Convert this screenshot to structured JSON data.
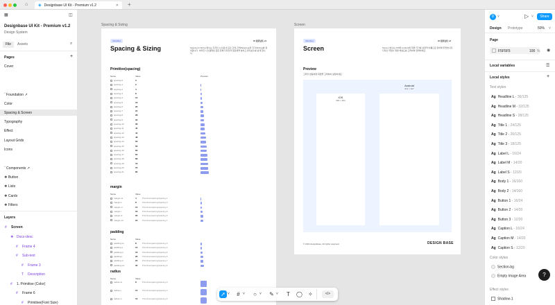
{
  "window": {
    "tab_title": "Designbase UI Kit - Premium v1.2",
    "new_tab": "+"
  },
  "left_panel": {
    "file_title": "Designbase UI Kit - Premium v1.2",
    "file_subtitle": "Design System",
    "tabs": [
      "File",
      "Assets"
    ],
    "pages_header": "Pages",
    "pages": [
      {
        "label": "Cover"
      },
      {
        "label": "ˇ Foundation ↗"
      },
      {
        "label": "Color"
      },
      {
        "label": "Spacing & Screen",
        "selected": true
      },
      {
        "label": "Typography"
      },
      {
        "label": "Effect"
      },
      {
        "label": "Layout Grids"
      },
      {
        "label": "Icons"
      },
      {
        "label": "ˇ Components ↗"
      },
      {
        "label": "❖ Button"
      },
      {
        "label": "❖ Lists"
      },
      {
        "label": "❖ Cards"
      },
      {
        "label": "❖ Filters"
      }
    ],
    "layers_header": "Layers",
    "layers": [
      {
        "label": "Screen",
        "icon": "frame"
      },
      {
        "label": "Docs-desc",
        "icon": "component"
      },
      {
        "label": "Frame 4",
        "icon": "frame"
      },
      {
        "label": "Sub-text",
        "icon": "frame"
      },
      {
        "label": "Frame 3",
        "icon": "frame"
      },
      {
        "label": "Description",
        "icon": "text"
      },
      {
        "label": "1. Primitive (Color)",
        "icon": "frame"
      },
      {
        "label": "Frame 6",
        "icon": "frame"
      },
      {
        "label": "Primitive(Font Size)",
        "icon": "frame"
      },
      {
        "label": "Preview",
        "icon": "text"
      }
    ]
  },
  "canvas": {
    "frame1": {
      "label": "Spacing & Sizing",
      "badge": "Variables",
      "title": "Spacing & Sizing",
      "version": "UI 컴포넌트 v1",
      "desc": "Spacing & Sizing 변수는 디자인 시스템 내 요소 간의 간격(Spacing)과 크기(Sizing)를 정의합니다. 이러한 시스템화된 값은 전체 디자인의 일관성을 높이고 유지보수를 쉽게 합니다.",
      "section1": "Primitive(spacing)",
      "col_name": "Name",
      "col_value": "Value",
      "col_preview": "Preview",
      "spacing": [
        {
          "name": "spacing-0",
          "value": "0"
        },
        {
          "name": "spacing-1",
          "value": "2"
        },
        {
          "name": "spacing-2",
          "value": "4"
        },
        {
          "name": "spacing-3",
          "value": "8"
        },
        {
          "name": "spacing-4",
          "value": "12"
        },
        {
          "name": "spacing-5",
          "value": "16"
        },
        {
          "name": "spacing-6",
          "value": "20"
        },
        {
          "name": "spacing-7",
          "value": "24"
        },
        {
          "name": "spacing-8",
          "value": "28"
        },
        {
          "name": "spacing-9",
          "value": "32"
        },
        {
          "name": "spacing-10",
          "value": "36"
        },
        {
          "name": "spacing-11",
          "value": "40"
        },
        {
          "name": "spacing-12",
          "value": "44"
        },
        {
          "name": "spacing-13",
          "value": "48"
        },
        {
          "name": "spacing-14",
          "value": "52"
        },
        {
          "name": "spacing-15",
          "value": "56"
        },
        {
          "name": "spacing-16",
          "value": "60"
        },
        {
          "name": "spacing-17",
          "value": "64"
        },
        {
          "name": "spacing-18",
          "value": "68"
        },
        {
          "name": "spacing-19",
          "value": "72"
        },
        {
          "name": "spacing-20",
          "value": "76"
        },
        {
          "name": "spacing-21",
          "value": "80"
        }
      ],
      "section2": "margin",
      "margin": [
        {
          "name": "margin-xs",
          "value": "4",
          "ref": "Primitive/spacing/spacing-1"
        },
        {
          "name": "margin-s",
          "value": "8",
          "ref": "Primitive/spacing/spacing-3"
        },
        {
          "name": "margin-m",
          "value": "12",
          "ref": "Primitive/spacing/spacing-4"
        },
        {
          "name": "margin-l",
          "value": "16",
          "ref": "Primitive/spacing/spacing-5"
        },
        {
          "name": "margin-xl",
          "value": "20",
          "ref": "Primitive/spacing/spacing-6"
        },
        {
          "name": "margin-xxl",
          "value": "24",
          "ref": "Primitive/spacing/spacing-7"
        }
      ],
      "section3": "padding",
      "padding": [
        {
          "name": "padding-xs",
          "value": "8",
          "ref": "Primitive/spacing/spacing-3"
        },
        {
          "name": "padding-s",
          "value": "12",
          "ref": "Primitive/spacing/spacing-4"
        },
        {
          "name": "padding-m",
          "value": "16",
          "ref": "Primitive/spacing/spacing-5"
        },
        {
          "name": "padding-l",
          "value": "20",
          "ref": "Primitive/spacing/spacing-6"
        },
        {
          "name": "padding-xl",
          "value": "24",
          "ref": "Primitive/spacing/spacing-7"
        },
        {
          "name": "padding-xxl",
          "value": "32",
          "ref": "Primitive/spacing/spacing-9"
        }
      ],
      "section4": "radius",
      "radius": [
        {
          "name": "radius-xs",
          "value": "8",
          "ref": "Primitive/spacing/spacing-3"
        },
        {
          "name": "radius-s",
          "value": "12",
          "ref": "Primitive/spacing/spacing-4"
        },
        {
          "name": "radius-m",
          "value": "16",
          "ref": "Primitive/spacing/spacing-5"
        },
        {
          "name": "radius-l",
          "value": "20",
          "ref": "Primitive/spacing/spacing-6"
        }
      ]
    },
    "frame2": {
      "label": "Screen",
      "badge": "Variables",
      "title": "Screen",
      "version": "UI 컴포넌트 v1",
      "desc": "Screen 변수는 iOS와 Android의 화면 크기를 상징적 이름으로 정의해 두었습니다. 디자인 작업시 화면 해상도를 고려하여 선택하세요.",
      "section1": "Preview",
      "preview_desc": "고려할 변동하면 화면을 고려하여 설정하세요.",
      "ios_label": "iOS",
      "ios_size": "390 × 844",
      "android_label": "Android",
      "android_size": "412 × 917",
      "footer_left": "© 2024 designbase. All rights reserved.",
      "footer_right": "DESIGN BASE"
    }
  },
  "toolbar": {
    "tools": [
      "move-tool",
      "frame-tool",
      "shape-tool",
      "pen-tool",
      "text-tool",
      "comment-tool",
      "actions-tool",
      "dev-mode-toggle"
    ]
  },
  "right_panel": {
    "avatar_letter": "D",
    "share_label": "Share",
    "tabs": [
      "Design",
      "Prototype"
    ],
    "zoom": "50%",
    "page_header": "Page",
    "page_color": "F5F5F5",
    "page_opacity": "100",
    "page_opacity_unit": "%",
    "local_variables": "Local variables",
    "local_styles": "Local styles",
    "text_styles_header": "Text styles",
    "text_styles": [
      {
        "name": "Headline L",
        "size": "36/125"
      },
      {
        "name": "Headline M",
        "size": "32/125"
      },
      {
        "name": "Headline S",
        "size": "28/125"
      },
      {
        "name": "Title 1",
        "size": "24/125"
      },
      {
        "name": "Title 2",
        "size": "20/125"
      },
      {
        "name": "Title 3",
        "size": "18/125"
      },
      {
        "name": "Label L",
        "size": "16/24"
      },
      {
        "name": "Label M",
        "size": "14/20"
      },
      {
        "name": "Label S",
        "size": "12/20"
      },
      {
        "name": "Body 1",
        "size": "16/160"
      },
      {
        "name": "Body 2",
        "size": "14/160"
      },
      {
        "name": "Button 1",
        "size": "16/24"
      },
      {
        "name": "Button 2",
        "size": "14/20"
      },
      {
        "name": "Button 3",
        "size": "12/20"
      },
      {
        "name": "Caption L",
        "size": "16/24"
      },
      {
        "name": "Caption M",
        "size": "14/20"
      },
      {
        "name": "Caption S",
        "size": "12/20"
      }
    ],
    "color_styles_header": "Color styles",
    "color_styles": [
      "Section-bg",
      "Empty Image Area"
    ],
    "effect_styles_header": "Effect styles",
    "effect_styles": [
      "Shadow-1",
      "Shadow-2"
    ]
  },
  "colors": {
    "accent": "#0d99ff",
    "purple": "#7b3fe4",
    "bar": "#8e9cf0",
    "preview_bg": "#eef4ff"
  }
}
